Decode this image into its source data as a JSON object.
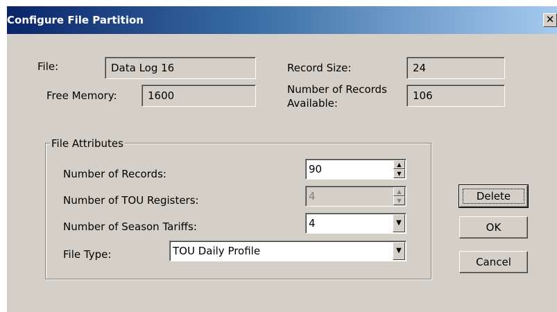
{
  "window": {
    "title": "Configure File Partition",
    "close_glyph": "✕"
  },
  "info": {
    "file_label": "File:",
    "file_value": "Data Log 16",
    "free_memory_label": "Free Memory:",
    "free_memory_value": "1600",
    "record_size_label": "Record Size:",
    "record_size_value": "24",
    "num_records_available_label_line1": "Number of Records",
    "num_records_available_label_line2": "Available:",
    "num_records_available_value": "106"
  },
  "attributes": {
    "group_label": "File Attributes",
    "num_records_label": "Number of Records:",
    "num_records_value": "90",
    "num_tou_registers_label": "Number of TOU Registers:",
    "num_tou_registers_value": "4",
    "num_tou_registers_enabled": false,
    "num_season_tariffs_label": "Number of Season Tariffs:",
    "num_season_tariffs_value": "4",
    "file_type_label": "File Type:",
    "file_type_value": "TOU Daily Profile"
  },
  "buttons": {
    "delete_label": "Delete",
    "ok_label": "OK",
    "cancel_label": "Cancel"
  },
  "icons": {
    "spin_up": "▲",
    "spin_down": "▼",
    "dropdown": "▼"
  },
  "colors": {
    "dialog_bg": "#d4d0c8",
    "titlebar_start": "#0a246a",
    "titlebar_end": "#a6caf0",
    "title_text": "#ffffff"
  }
}
